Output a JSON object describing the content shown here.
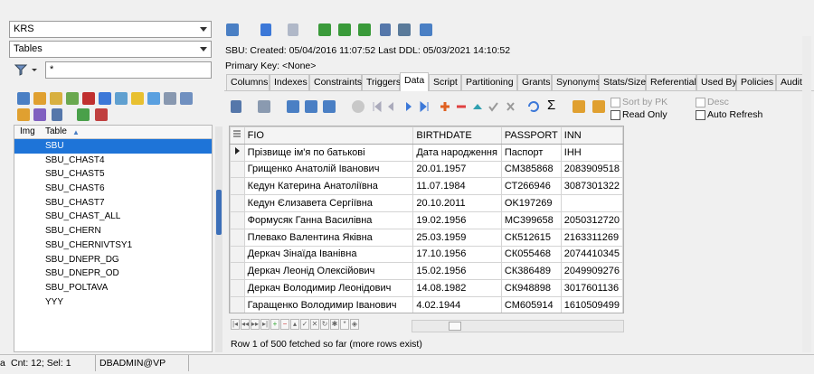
{
  "left": {
    "schema_select": "KRS",
    "object_type_select": "Tables",
    "filter_value": "*",
    "list_headers": {
      "img": "Img",
      "table": "Table"
    },
    "tables": [
      "SBU",
      "SBU_CHAST4",
      "SBU_CHAST5",
      "SBU_CHAST6",
      "SBU_CHAST7",
      "SBU_CHAST_ALL",
      "SBU_CHERN",
      "SBU_CHERNIVTSY1",
      "SBU_DNEPR_DG",
      "SBU_DNEPR_OD",
      "SBU_POLTAVA",
      "YYY"
    ],
    "selected_index": 0
  },
  "info": {
    "line1": "SBU:  Created: 05/04/2016 11:07:52  Last DDL: 05/03/2021 14:10:52",
    "primary_key": "Primary Key:  <None>"
  },
  "tabs": [
    "Columns",
    "Indexes",
    "Constraints",
    "Triggers",
    "Data",
    "Script",
    "Partitioning",
    "Grants",
    "Synonyms",
    "Stats/Size",
    "Referential",
    "Used By",
    "Policies",
    "Auditi"
  ],
  "active_tab": "Data",
  "data_toolbar": {
    "sort_by_pk": "Sort by PK",
    "read_only": "Read Only",
    "desc": "Desc",
    "auto_refresh": "Auto Refresh",
    "sigma": "Σ"
  },
  "grid": {
    "columns": [
      "FIO",
      "BIRTHDATE",
      "PASSPORT",
      "INN"
    ],
    "rows": [
      [
        "Прізвище ім'я по батькові",
        "Дата народження",
        "Паспорт",
        "ІНН"
      ],
      [
        "Грищенко Анатолій Іванович",
        "20.01.1957",
        "СМ385868",
        "2083909518"
      ],
      [
        "Кедун Катерина Анатоліївна",
        "11.07.1984",
        "СТ266946",
        "3087301322"
      ],
      [
        "Кедун Єлизавета Сергіївна",
        "20.10.2011",
        "OK197269",
        ""
      ],
      [
        "Формусяк Ганна Василівна",
        "19.02.1956",
        "МС399658",
        "2050312720"
      ],
      [
        "Плевако Валентина Яківна",
        "25.03.1959",
        "СК512615",
        "2163311269"
      ],
      [
        "Деркач Зінаїда Іванівна",
        "17.10.1956",
        "СК055468",
        "2074410345"
      ],
      [
        "Деркач Леонід Олексійович",
        "15.02.1956",
        "СК386489",
        "2049909276"
      ],
      [
        "Деркач Володимир Леонідович",
        "14.08.1982",
        "СК948898",
        "3017601136"
      ],
      [
        "Гаращенко Володимир Іванович",
        "4.02.1944",
        "СМ605914",
        "1610509499"
      ]
    ]
  },
  "status_fetch": "Row 1 of 500 fetched so far (more rows exist)",
  "statusbar": {
    "left_char": "a",
    "count": "Cnt: 12; Sel: 1",
    "user": "DBADMIN@VP"
  }
}
